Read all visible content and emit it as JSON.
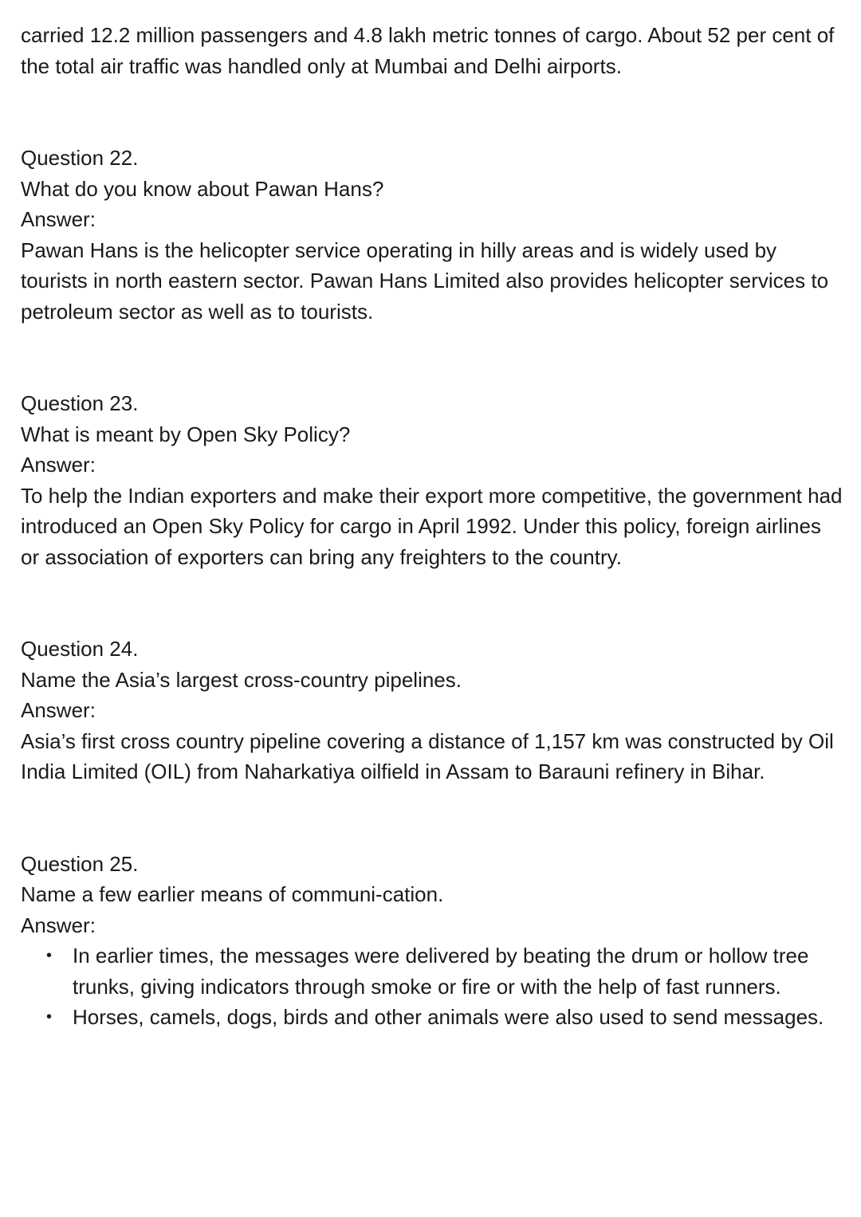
{
  "intro": {
    "text": "carried 12.2 million passengers and 4.8 lakh metric tonnes of cargo. About 52 per cent of the total air traffic was handled only at Mumbai and Delhi airports."
  },
  "questions": [
    {
      "heading": "Question 22.",
      "question": "What do you know about Pawan Hans?",
      "answer_label": "Answer:",
      "answer": "Pawan Hans is the helicopter service operating in hilly areas and is widely used by tourists in north eastern sector. Pawan Hans Limited also provides helicopter services to petroleum sector as well as to tourists."
    },
    {
      "heading": "Question 23.",
      "question": "What is meant by Open Sky Policy?",
      "answer_label": "Answer:",
      "answer": "To help the Indian exporters and make their export more competitive, the government had introduced an Open Sky Policy for cargo in April 1992. Under this policy, foreign airlines or association of exporters can bring any freighters to the country."
    },
    {
      "heading": "Question 24.",
      "question": "Name the Asia’s largest cross-country pipelines.",
      "answer_label": "Answer:",
      "answer": "Asia’s first cross country pipeline covering a distance of 1,157 km was constructed by Oil India Limited (OIL) from Naharkatiya oilfield in Assam to Barauni refinery in Bihar."
    },
    {
      "heading": "Question 25.",
      "question": "Name a few earlier means of communi-cation.",
      "answer_label": "Answer:",
      "bullets": [
        "In earlier times, the messages were delivered by beating the drum or hollow tree trunks, giving indicators through smoke or fire or with the help of fast runners.",
        "Horses, camels, dogs, birds and other animals were also used to send messages."
      ]
    }
  ]
}
